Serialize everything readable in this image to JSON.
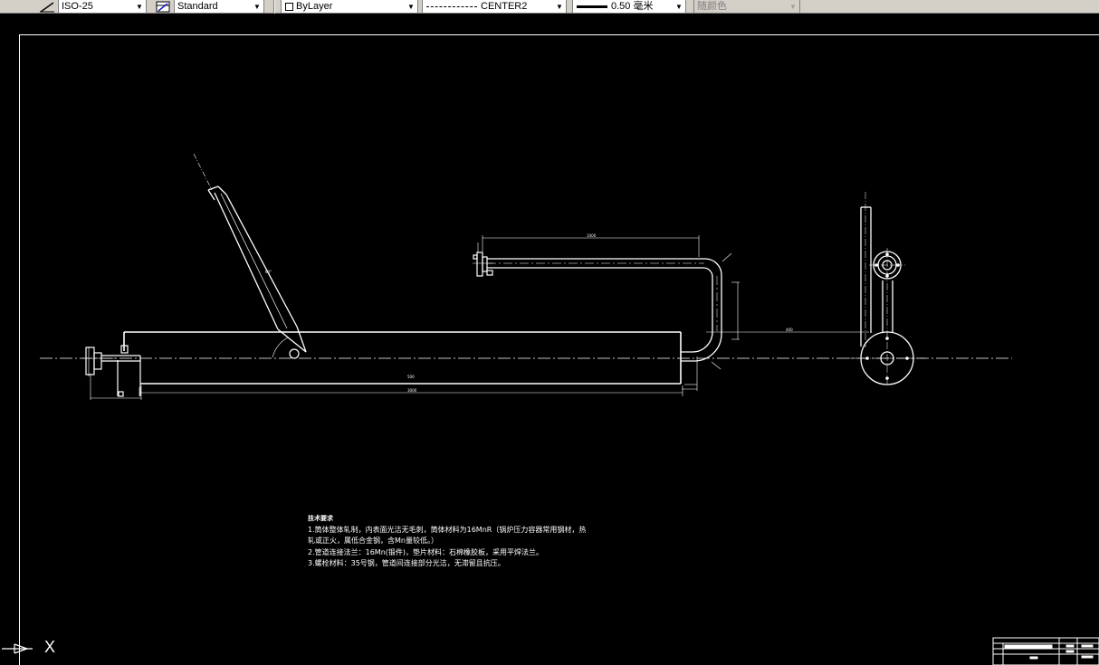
{
  "toolbar": {
    "dimstyle": "ISO-25",
    "tablestyle": "Standard",
    "layer": "ByLayer",
    "linetype": "CENTER2",
    "lineweight": "0.50 毫米",
    "plotstyle": "随颜色"
  },
  "drawing": {
    "dims": {
      "top_length": "1000",
      "mid_length": "500",
      "bottom_length": "3000",
      "right_offset": "400",
      "angle": "60°"
    },
    "notes": {
      "title": "技术要求",
      "line1": "1.筒体整体轧制，内表面光洁无毛刺，筒体材料为16MnR（锅炉压力容器常用钢材，热",
      "line2": "轧或正火，属低合金钢，含Mn量较低。）",
      "line3": "2.管道连接法兰：16Mn(锻件)，垫片材料：石棉橡胶板，采用平焊法兰。",
      "line4": "3.螺栓材料：35号钢，管道间连接部分光洁，无滞留且抗压。"
    },
    "ucs_axis_x": "X"
  }
}
